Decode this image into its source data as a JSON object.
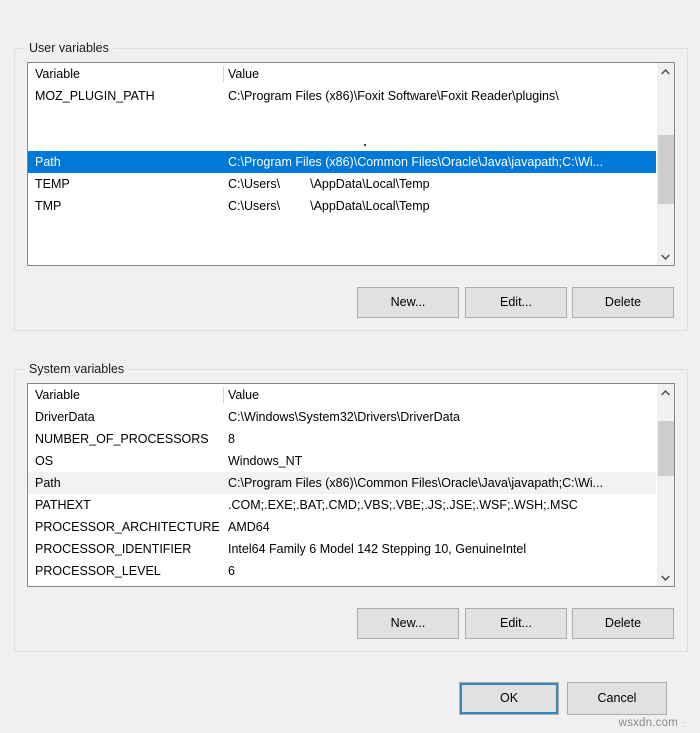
{
  "dialog": {
    "watermark": "wsxdn.com",
    "watermark_dots": "::"
  },
  "user_section": {
    "title": "User variables",
    "columns": {
      "variable": "Variable",
      "value": "Value"
    },
    "rows": [
      {
        "variable": "MOZ_PLUGIN_PATH",
        "value": "C:\\Program Files (x86)\\Foxit Software\\Foxit Reader\\plugins\\",
        "state": "normal"
      },
      {
        "variable": "",
        "value": "",
        "state": "normal"
      },
      {
        "variable": "",
        "value": "",
        "state": "normal"
      },
      {
        "variable": "Path",
        "value": "C:\\Program Files (x86)\\Common Files\\Oracle\\Java\\javapath;C:\\Wi...",
        "state": "selected"
      },
      {
        "variable": "TEMP",
        "value_prefix": "C:\\Users\\",
        "value_suffix": "\\AppData\\Local\\Temp",
        "redacted": true,
        "state": "normal"
      },
      {
        "variable": "TMP",
        "value_prefix": "C:\\Users\\",
        "value_suffix": "\\AppData\\Local\\Temp",
        "redacted": true,
        "state": "normal"
      }
    ],
    "buttons": {
      "new": "New...",
      "edit": "Edit...",
      "delete": "Delete"
    },
    "scrollbar": {
      "up": "scroll-up",
      "down": "scroll-down",
      "thumb_top_pct": 33,
      "thumb_height_pct": 42
    }
  },
  "system_section": {
    "title": "System variables",
    "columns": {
      "variable": "Variable",
      "value": "Value"
    },
    "rows": [
      {
        "variable": "DriverData",
        "value": "C:\\Windows\\System32\\Drivers\\DriverData",
        "state": "normal"
      },
      {
        "variable": "NUMBER_OF_PROCESSORS",
        "value": "8",
        "state": "normal"
      },
      {
        "variable": "OS",
        "value": "Windows_NT",
        "state": "normal"
      },
      {
        "variable": "Path",
        "value": "C:\\Program Files (x86)\\Common Files\\Oracle\\Java\\javapath;C:\\Wi...",
        "state": "hovered"
      },
      {
        "variable": "PATHEXT",
        "value": ".COM;.EXE;.BAT;.CMD;.VBS;.VBE;.JS;.JSE;.WSF;.WSH;.MSC",
        "state": "normal"
      },
      {
        "variable": "PROCESSOR_ARCHITECTURE",
        "value": "AMD64",
        "state": "normal"
      },
      {
        "variable": "PROCESSOR_IDENTIFIER",
        "value": "Intel64 Family 6 Model 142 Stepping 10, GenuineIntel",
        "state": "normal"
      },
      {
        "variable": "PROCESSOR_LEVEL",
        "value": "6",
        "state": "normal"
      }
    ],
    "buttons": {
      "new": "New...",
      "edit": "Edit...",
      "delete": "Delete"
    },
    "scrollbar": {
      "up": "scroll-up",
      "down": "scroll-down",
      "thumb_top_pct": 12,
      "thumb_height_pct": 33
    }
  },
  "footer": {
    "ok": "OK",
    "cancel": "Cancel"
  },
  "colors": {
    "selection_blue": "#0078d7",
    "hover_gray": "#f2f2f2",
    "dialog_bg": "#f0f0f0",
    "button_bg": "#e1e1e1",
    "focus_outline": "#3388bb"
  }
}
